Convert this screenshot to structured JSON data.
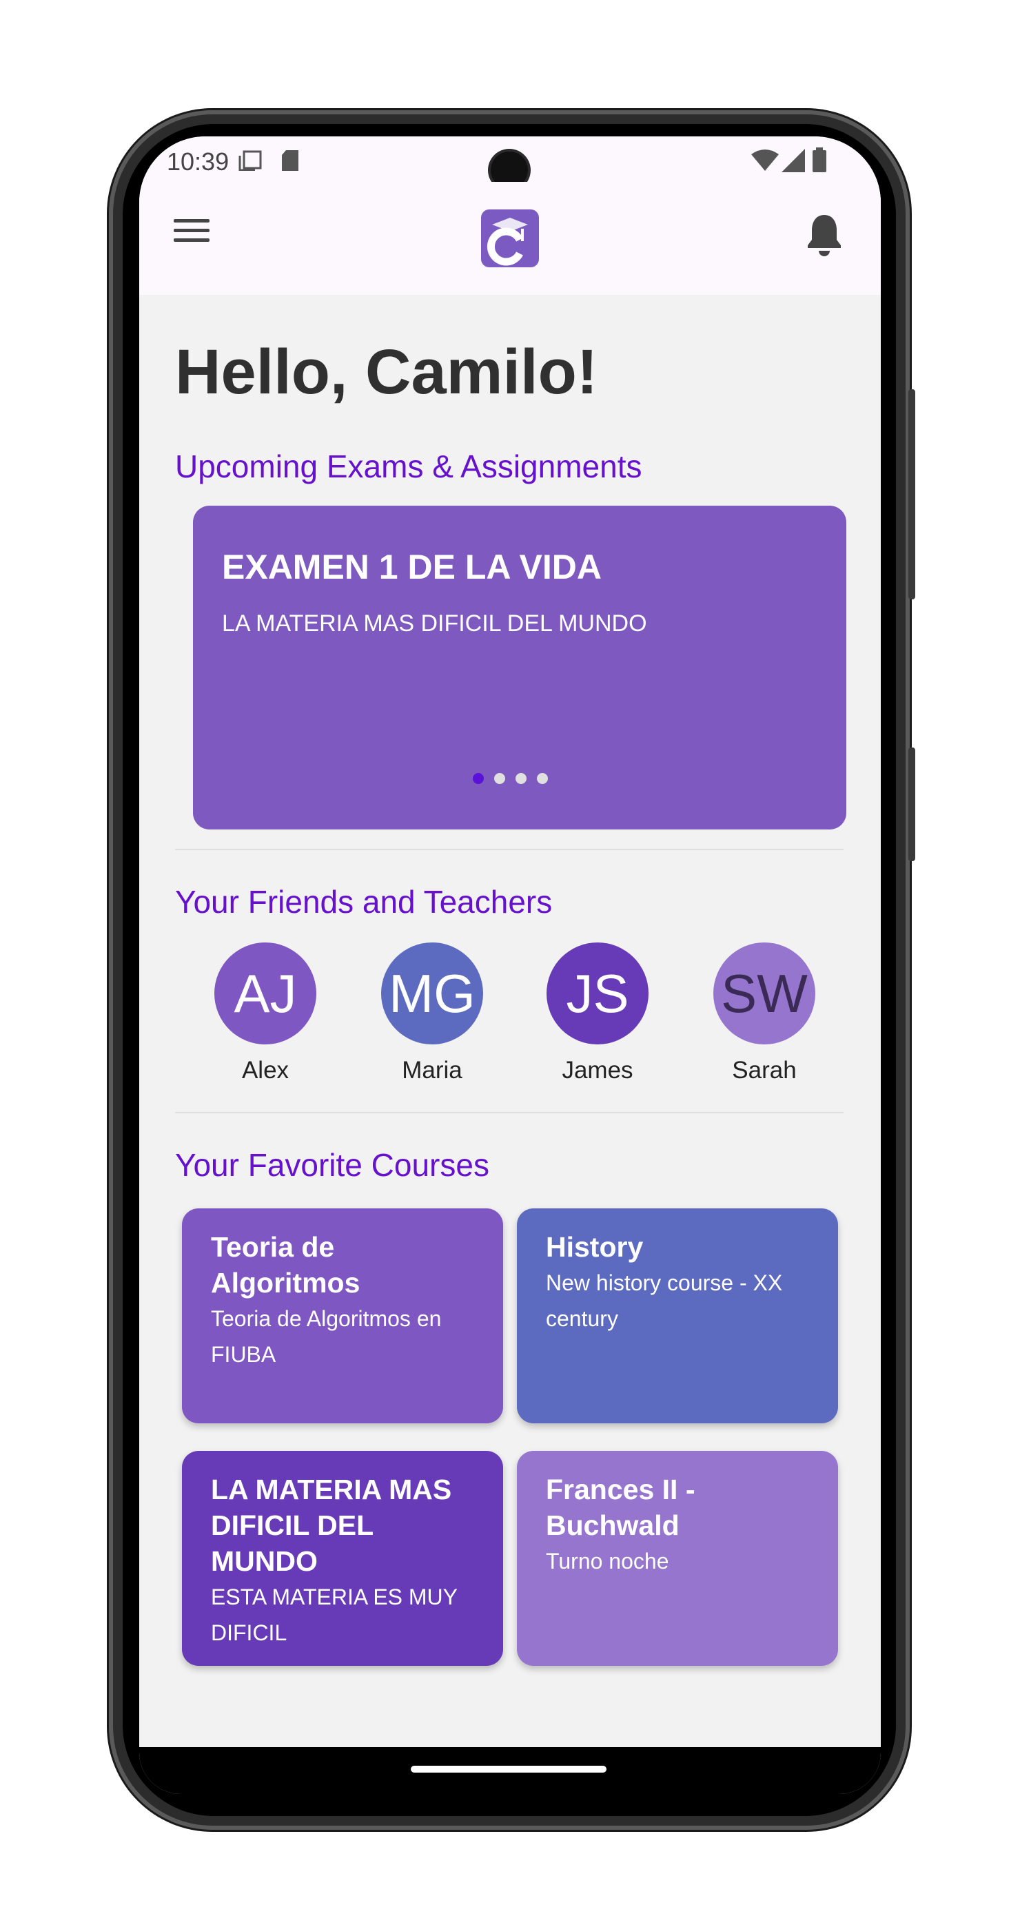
{
  "status": {
    "time": "10:39"
  },
  "appbar": {
    "menu_icon": "menu-icon",
    "logo_icon": "graduation-cap-logo-icon",
    "notification_icon": "bell-icon"
  },
  "greeting": "Hello, Camilo!",
  "exams": {
    "title": "Upcoming Exams & Assignments",
    "card": {
      "title": "EXAMEN 1 DE LA VIDA",
      "subtitle": "LA MATERIA MAS DIFICIL DEL MUNDO"
    },
    "pager": {
      "count": 4,
      "active": 1,
      "active_color": "#5b12d8",
      "inactive_color": "#e0e0e0"
    }
  },
  "friends": {
    "title": "Your Friends and Teachers",
    "items": [
      {
        "initials": "AJ",
        "name": "Alex",
        "color": "#7e57c2"
      },
      {
        "initials": "MG",
        "name": "Maria",
        "color": "#5c6bc0"
      },
      {
        "initials": "JS",
        "name": "James",
        "color": "#673ab7"
      },
      {
        "initials": "SW",
        "name": "Sarah",
        "color": "#9575cd"
      }
    ]
  },
  "courses": {
    "title": "Your Favorite Courses",
    "items": [
      {
        "title": "Teoria de Algoritmos",
        "description": "Teoria de Algoritmos en FIUBA",
        "color": "#7e57c2"
      },
      {
        "title": "History",
        "description": "New history course - XX century",
        "color": "#5c6bc0"
      },
      {
        "title": "LA MATERIA MAS DIFICIL DEL MUNDO",
        "description": "ESTA MATERIA ES MUY DIFICIL",
        "color": "#673ab7"
      },
      {
        "title": "Frances II - Buchwald",
        "description": "Turno noche",
        "color": "#9575cd"
      }
    ]
  },
  "colors": {
    "accent": "#6611cc",
    "appbar_bg": "#fdf8fd",
    "screen_bg": "#f2f2f2"
  }
}
